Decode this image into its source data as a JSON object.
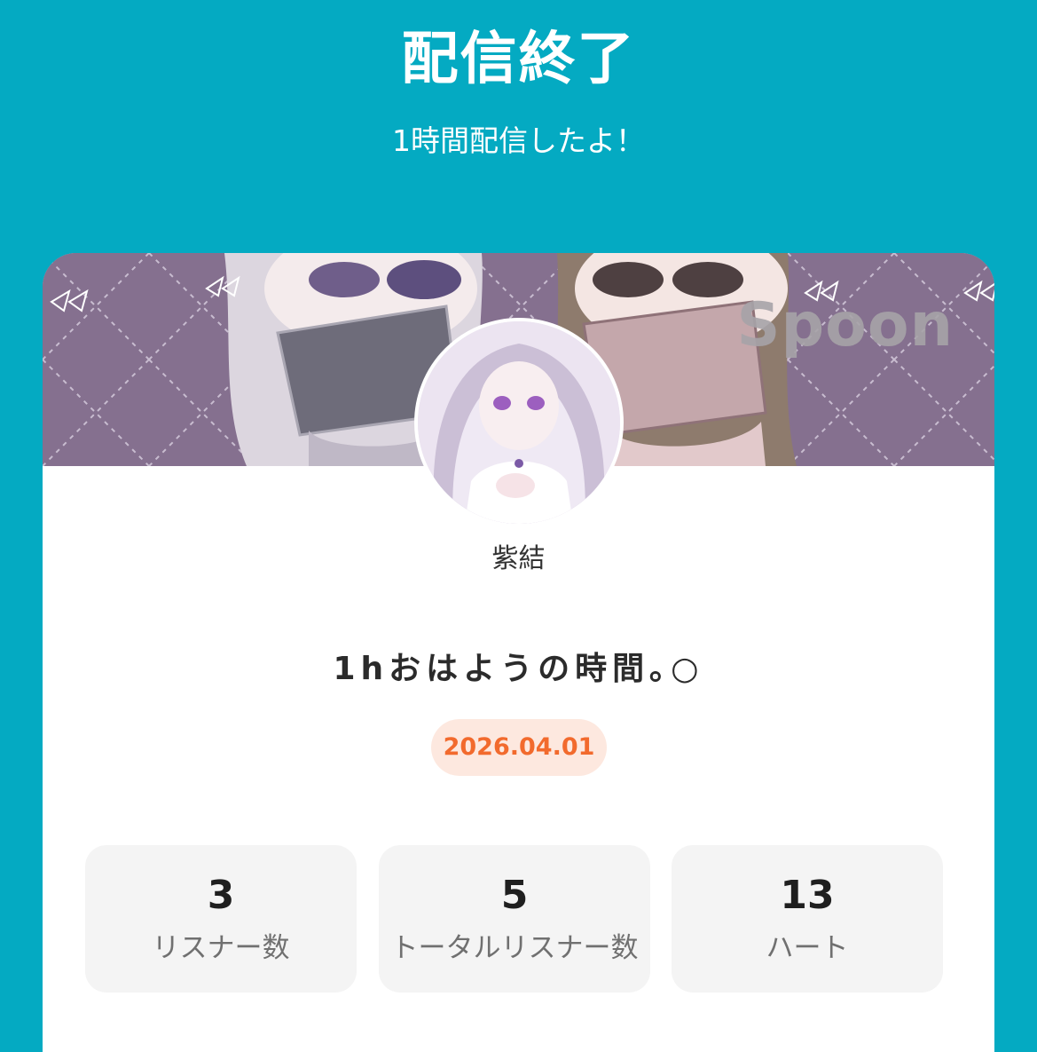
{
  "header": {
    "title": "配信終了",
    "subtitle": "1時間配信したよ！"
  },
  "banner": {
    "watermark": "Spoon"
  },
  "host": {
    "name": "紫結"
  },
  "broadcast": {
    "title": "1hおはようの時間｡○",
    "date": "2026.04.01"
  },
  "stats": [
    {
      "value": "3",
      "label": "リスナー数"
    },
    {
      "value": "5",
      "label": "トータルリスナー数"
    },
    {
      "value": "13",
      "label": "ハート"
    }
  ],
  "colors": {
    "background": "#04aac2",
    "banner": "#8a7495",
    "date_badge_bg": "#fde8df",
    "date_badge_text": "#f26a2d",
    "stat_card_bg": "#f4f4f4"
  }
}
